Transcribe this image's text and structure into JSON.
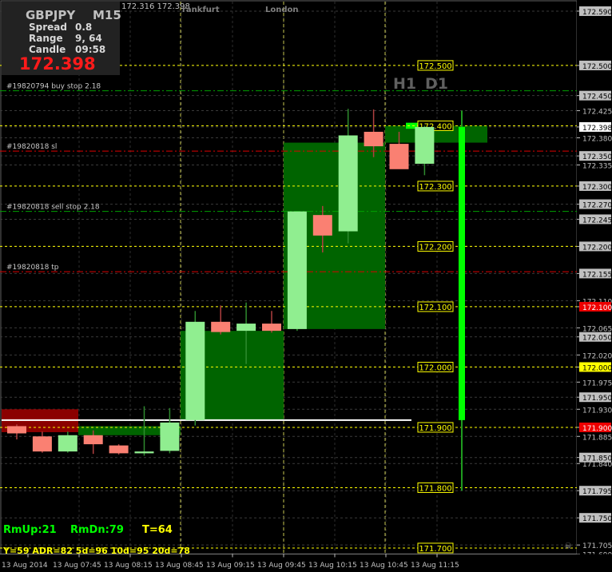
{
  "info": {
    "symbol": "GBPJPY",
    "timeframe": "M15",
    "spread_label": "Spread",
    "spread_value": "0.8",
    "range_label": "Range",
    "range_value": "9, 64",
    "candle_label": "Candle",
    "candle_value": "09:58",
    "price": "172.398"
  },
  "header_prices": "172.316 172.398",
  "sessions": {
    "frankfurt": "rankfurt",
    "london": "London"
  },
  "tf_labels": {
    "h1": "H1",
    "d1": "D1"
  },
  "stats": {
    "rm_up": "RmUp:21",
    "rm_dn": "RmDn:79",
    "t": "T=64"
  },
  "adr_line": "Y=59  ADR=82  5d=96  10d=95  20d=78",
  "colors": {
    "bull": "#90ee90",
    "bear": "#fa8072",
    "green_box": "#006400",
    "red_box": "#8b0000",
    "yellow": "#ffff00",
    "red_line": "#dd0000",
    "green_line": "#00a000",
    "bright_green": "#00ff00"
  },
  "chart_data": {
    "type": "candlestick",
    "ylim": [
      171.69,
      172.582
    ],
    "x_tick_labels": [
      "13 Aug 2014",
      "13 Aug 07:45",
      "13 Aug 08:15",
      "13 Aug 08:45",
      "13 Aug 09:15",
      "13 Aug 09:45",
      "13 Aug 10:15",
      "13 Aug 10:45",
      "13 Aug 11:15"
    ],
    "y_tick_labels": [
      "172.590",
      "172.500",
      "172.450",
      "172.425",
      "172.398",
      "172.380",
      "172.350",
      "172.335",
      "172.300",
      "172.270",
      "172.245",
      "172.200",
      "172.155",
      "172.110",
      "172.100",
      "172.065",
      "172.050",
      "172.020",
      "172.000",
      "171.975",
      "171.950",
      "171.930",
      "171.900",
      "171.885",
      "171.850",
      "171.840",
      "171.795",
      "171.750",
      "171.705",
      "171.690"
    ],
    "candles": [
      {
        "o": 171.902,
        "h": 171.905,
        "l": 171.88,
        "c": 171.89
      },
      {
        "o": 171.885,
        "h": 171.893,
        "l": 171.858,
        "c": 171.86
      },
      {
        "o": 171.86,
        "h": 171.893,
        "l": 171.858,
        "c": 171.887
      },
      {
        "o": 171.887,
        "h": 171.895,
        "l": 171.856,
        "c": 171.872
      },
      {
        "o": 171.87,
        "h": 171.872,
        "l": 171.855,
        "c": 171.857
      },
      {
        "o": 171.857,
        "h": 171.935,
        "l": 171.853,
        "c": 171.86
      },
      {
        "o": 171.861,
        "h": 171.932,
        "l": 171.857,
        "c": 171.908
      },
      {
        "o": 171.912,
        "h": 172.093,
        "l": 171.903,
        "c": 172.075
      },
      {
        "o": 172.075,
        "h": 172.102,
        "l": 172.054,
        "c": 172.058
      },
      {
        "o": 172.06,
        "h": 172.107,
        "l": 172.005,
        "c": 172.072
      },
      {
        "o": 172.072,
        "h": 172.093,
        "l": 172.057,
        "c": 172.06
      },
      {
        "o": 172.063,
        "h": 172.245,
        "l": 172.06,
        "c": 172.258
      },
      {
        "o": 172.252,
        "h": 172.267,
        "l": 172.19,
        "c": 172.218
      },
      {
        "o": 172.225,
        "h": 172.428,
        "l": 172.205,
        "c": 172.384
      },
      {
        "o": 172.39,
        "h": 172.427,
        "l": 172.348,
        "c": 172.366
      },
      {
        "o": 172.37,
        "h": 172.39,
        "l": 172.33,
        "c": 172.328
      },
      {
        "o": 172.337,
        "h": 172.4,
        "l": 172.318,
        "c": 172.398
      }
    ],
    "levels": [
      {
        "price": 172.5,
        "label": "172.500"
      },
      {
        "price": 172.4,
        "label": "172.400"
      },
      {
        "price": 172.3,
        "label": "172.300"
      },
      {
        "price": 172.2,
        "label": "172.200"
      },
      {
        "price": 172.1,
        "label": "172.100"
      },
      {
        "price": 172.0,
        "label": "172.000"
      },
      {
        "price": 171.9,
        "label": "171.900"
      },
      {
        "price": 171.8,
        "label": "171.800"
      },
      {
        "price": 171.7,
        "label": "171.700"
      }
    ],
    "orders": [
      {
        "label": "#19820794 buy stop 2.18",
        "price": 172.458
      },
      {
        "label": "#19820818 sl",
        "price": 172.358
      },
      {
        "label": "#19820818 sell stop 2.18",
        "price": 172.258
      },
      {
        "label": "#19820818 tp",
        "price": 172.158
      }
    ],
    "daily_bar": {
      "open": 171.912,
      "close": 172.398,
      "high": 172.425,
      "low": 171.795
    }
  }
}
